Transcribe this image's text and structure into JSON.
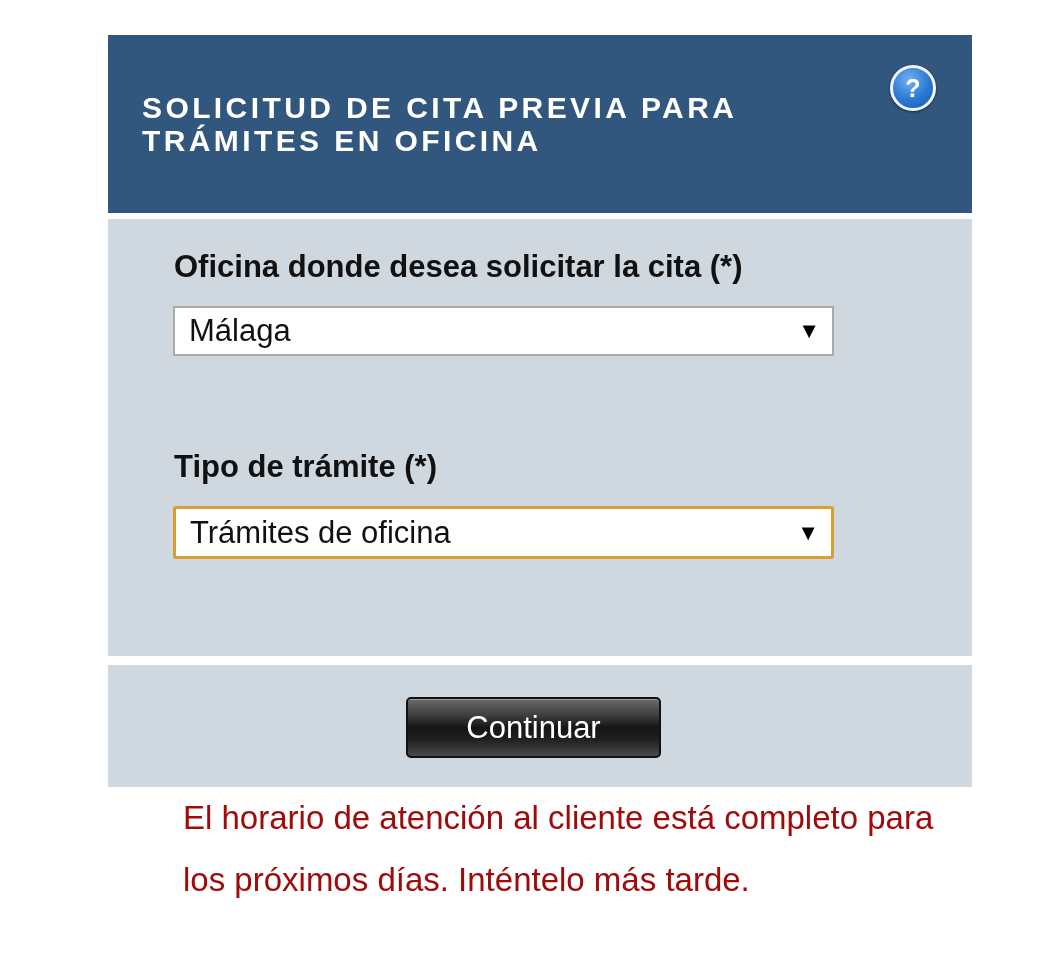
{
  "header": {
    "title_lines": [
      "SOLICITUD DE CITA PREVIA PARA",
      "TRÁMITES EN OFICINA"
    ],
    "help_glyph": "?"
  },
  "fields": [
    {
      "label": "Oficina donde desea solicitar la cita (*)",
      "value": "Málaga",
      "arrow": "▼",
      "focused": false
    },
    {
      "label": "Tipo de trámite (*)",
      "value": "Trámites de oficina",
      "arrow": "▼",
      "focused": true
    }
  ],
  "button": {
    "label": "Continuar"
  },
  "message": {
    "kind": "error",
    "text": "El horario de atención al cliente está completo para los próximos días. Inténtelo más tarde."
  }
}
